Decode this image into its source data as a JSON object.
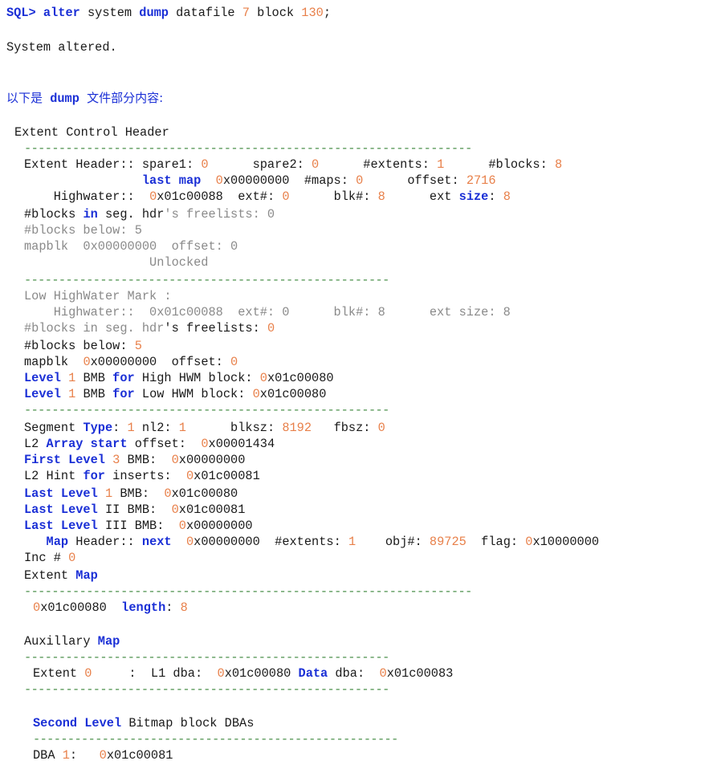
{
  "command": {
    "prompt": "SQL>",
    "kw_alter": "alter",
    "system": "system",
    "kw_dump": "dump",
    "datafile": "datafile",
    "file_no": "7",
    "block": "block",
    "block_no": "130",
    "semicolon": ";"
  },
  "result": "System altered.",
  "intro": {
    "prefix": "以下是",
    "kw": "dump",
    "suffix": "文件部分内容:"
  },
  "ech": {
    "title": "Extent Control Header",
    "dashes_long": "-----------------------------------------------------------------",
    "dashes_short": "-----------------------------------------------------",
    "l1": {
      "label": "Extent Header:: spare1: ",
      "spare1": "0",
      "spare2_label": "      spare2: ",
      "spare2": "0",
      "extents_label": "      #extents: ",
      "extents": "1",
      "blocks_label": "      #blocks: ",
      "blocks": "8"
    },
    "l2": {
      "pad": "                ",
      "kw": "last map",
      "sp": "  ",
      "hex0": "0",
      "hex": "x00000000",
      "maps_label": "  #maps: ",
      "maps": "0",
      "offset_label": "      offset: ",
      "offset": "2716"
    },
    "l3": {
      "label": "    Highwater::  ",
      "hex0": "0",
      "hex": "x01c00088",
      "ext_label": "  ext#: ",
      "ext": "0",
      "blk_label": "      blk#: ",
      "blk": "8",
      "extsize_label": "      ext ",
      "kw_size": "size",
      "colon": ": ",
      "extsize": "8"
    },
    "l4": {
      "pre": "#blocks ",
      "kw": "in",
      "mid": " seg. hdr",
      "gray": "'s freelists: 0"
    },
    "l5": "#blocks below: 5",
    "l6": "mapblk  0x00000000  offset: 0",
    "l7": "                 Unlocked"
  },
  "lhwm": {
    "title": "Low HighWater Mark :",
    "l1": "    Highwater::  0x01c00088  ext#: 0      blk#: 8      ext size: 8",
    "l2": {
      "gray": "#blocks in seg. hdr",
      "rest": "'s freelists: ",
      "val": "0"
    },
    "l3": {
      "label": "#blocks below: ",
      "val": "5"
    },
    "l4": {
      "label": "mapblk  ",
      "hex0": "0",
      "hex": "x00000000",
      "offset_label": "  offset: ",
      "offset": "0"
    },
    "l5": {
      "kw": "Level",
      "num": " 1",
      "mid": " BMB ",
      "kw2": "for",
      "rest": " High HWM block: ",
      "hex0": "0",
      "hex": "x01c00080"
    },
    "l6": {
      "kw": "Level",
      "num": " 1",
      "mid": " BMB ",
      "kw2": "for",
      "rest": " Low HWM block: ",
      "hex0": "0",
      "hex": "x01c00080"
    }
  },
  "seg": {
    "l1": {
      "label": "Segment ",
      "kw": "Type",
      "colon": ": ",
      "type": "1",
      "nl2_label": " nl2: ",
      "nl2": "1",
      "blksz_label": "      blksz: ",
      "blksz": "8192",
      "fbsz_label": "   fbsz: ",
      "fbsz": "0"
    },
    "l2": {
      "pre": "L2 ",
      "kw": "Array start",
      "rest": " offset:  ",
      "hex0": "0",
      "hex": "x00001434"
    },
    "l3": {
      "kw": "First Level",
      "num": " 3",
      "rest": " BMB:  ",
      "hex0": "0",
      "hex": "x00000000"
    },
    "l4": {
      "pre": "L2 Hint ",
      "kw": "for",
      "rest": " inserts:  ",
      "hex0": "0",
      "hex": "x01c00081"
    },
    "l5": {
      "kw": "Last Level",
      "num": " 1",
      "rest": " BMB:  ",
      "hex0": "0",
      "hex": "x01c00080"
    },
    "l6": {
      "kw": "Last Level",
      "rest": " II BMB:  ",
      "hex0": "0",
      "hex": "x01c00081"
    },
    "l7": {
      "kw": "Last Level",
      "rest": " III BMB:  ",
      "hex0": "0",
      "hex": "x00000000"
    },
    "l8": {
      "pad": "   ",
      "kw": "Map",
      "mid": " Header:: ",
      "kw2": "next",
      "sp": "  ",
      "hex0": "0",
      "hex": "x00000000",
      "ext_label": "  #extents: ",
      "ext": "1",
      "obj_label": "    obj#: ",
      "obj": "89725",
      "flag_label": "  flag: ",
      "flag0": "0",
      "flag": "x10000000"
    },
    "l9": {
      "label": "Inc # ",
      "val": "0"
    },
    "l10": {
      "label": "Extent ",
      "kw": "Map"
    }
  },
  "extent_map": {
    "hex0": "0",
    "hex": "x01c00080",
    "sp": "  ",
    "kw": "length",
    "colon": ": ",
    "length": "8"
  },
  "aux": {
    "label": "Auxillary ",
    "kw": "Map",
    "row": {
      "label": "Extent ",
      "ext": "0",
      "mid": "     :  L1 dba:  ",
      "l1_0": "0",
      "l1": "x01c00080",
      "sp": " ",
      "kw": "Data",
      "dba_label": " dba:  ",
      "d_0": "0",
      "d": "x01c00083"
    }
  },
  "second": {
    "kw": "Second Level",
    "rest": " Bitmap block DBAs",
    "row": {
      "label": "DBA ",
      "num": "1",
      "colon": ":   ",
      "hex0": "0",
      "hex": "x01c00081"
    }
  }
}
